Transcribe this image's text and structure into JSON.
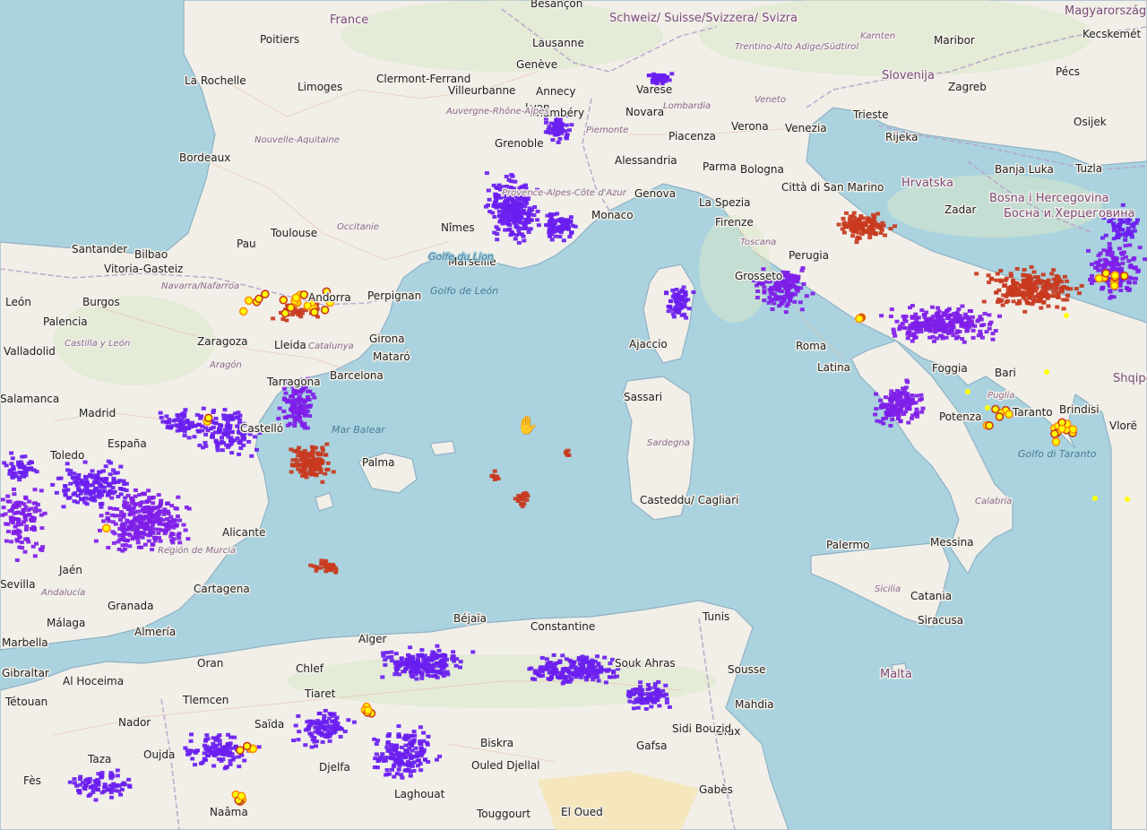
{
  "colors": {
    "sea": "#aad3df",
    "land": "#f2efe9",
    "land_green": "#d8e8c8",
    "border": "#b9a0c9",
    "coast": "#8fb2c4",
    "strike_recent": "#ffff00",
    "strike_orange": "#ff8c00",
    "strike_red": "#c83a1e",
    "strike_purple": "#7f1ee8",
    "strike_old": "#6a1ef0"
  },
  "icons": {
    "cursor": "hand-grab-icon"
  },
  "labels": {
    "countries": [
      "France",
      "Schweiz/ Suisse/Svizzera/ Svizra",
      "Magyarország",
      "Slovenija",
      "Hrvatska",
      "Bosna i Hercegovina",
      "Босна и Херцеговина",
      "Shqipëria",
      "Malta"
    ],
    "cities": [
      "Besançon",
      "Poitiers",
      "La Rochelle",
      "Limoges",
      "Clermont-Ferrand",
      "Villeurbanne",
      "Lyon",
      "Genève",
      "Lausanne",
      "Annecy",
      "Grenoble",
      "Chambéry",
      "Bordeaux",
      "Toulouse",
      "Pau",
      "Nîmes",
      "Marseille",
      "Monaco",
      "Genova",
      "Varese",
      "Novara",
      "Piacenza",
      "Verona",
      "Venezia",
      "Trieste",
      "Zagreb",
      "Maribor",
      "Pécs",
      "Kecskemét",
      "Osijek",
      "Rijeka",
      "Zadar",
      "Banja Luka",
      "Tuzla",
      "Alessandria",
      "Parma",
      "Bologna",
      "Città di San Marino",
      "La Spezia",
      "Firenze",
      "Perugia",
      "Grosseto",
      "Roma",
      "Latina",
      "Foggia",
      "Bari",
      "Brindisi",
      "Taranto",
      "Potenza",
      "Vlorë",
      "Santander",
      "Bilbao",
      "Vitoria-Gasteiz",
      "León",
      "Burgos",
      "Palencia",
      "Valladolid",
      "Zaragoza",
      "Lleida",
      "Andorra",
      "Perpignan",
      "Girona",
      "Mataró",
      "Barcelona",
      "Tarragona",
      "Castelló",
      "Madrid",
      "España",
      "Toledo",
      "Salamanca",
      "Alicante",
      "Cartagena",
      "Granada",
      "Málaga",
      "Almería",
      "Marbella",
      "Jaén",
      "Sevilla",
      "Palma",
      "Ajaccio",
      "Sassari",
      "Casteddu/ Cagliari",
      "Palermo",
      "Messina",
      "Catania",
      "Siracusa",
      "Gibraltar",
      "Tétouan",
      "Al Hoceima",
      "Nador",
      "Oujda",
      "Taza",
      "Fès",
      "Alger",
      "Oran",
      "Chlef",
      "Tiaret",
      "Tlemcen",
      "Saïda",
      "Béjaïa",
      "Constantine",
      "Souk Ahras",
      "Biskra",
      "Ouled Djellal",
      "Laghouat",
      "Touggourt",
      "Djelfa",
      "El Oued",
      "Tunis",
      "Sousse",
      "Sfax",
      "Gafsa",
      "Gabès",
      "Sidi Bouzid",
      "Mahdia",
      "Naâma"
    ],
    "regions": [
      "Nouvelle-Aquitaine",
      "Auvergne-Rhône-Alpes",
      "Occitanie",
      "Provence-Alpes-Côte d'Azur",
      "Piemonte",
      "Lombardia",
      "Veneto",
      "Toscana",
      "Trentino-Alto Adige/Südtirol",
      "Karnten",
      "Navarra/Nafarroa",
      "Catalunya",
      "Aragón",
      "Castilla y León",
      "Región de Murcia",
      "Andalucía",
      "Puglia",
      "Calabria",
      "Sicilia",
      "Sardegna"
    ],
    "seas": [
      "Golfe du Lion",
      "Golfo de León",
      "Mar Balear",
      "Golfo di Taranto"
    ]
  }
}
